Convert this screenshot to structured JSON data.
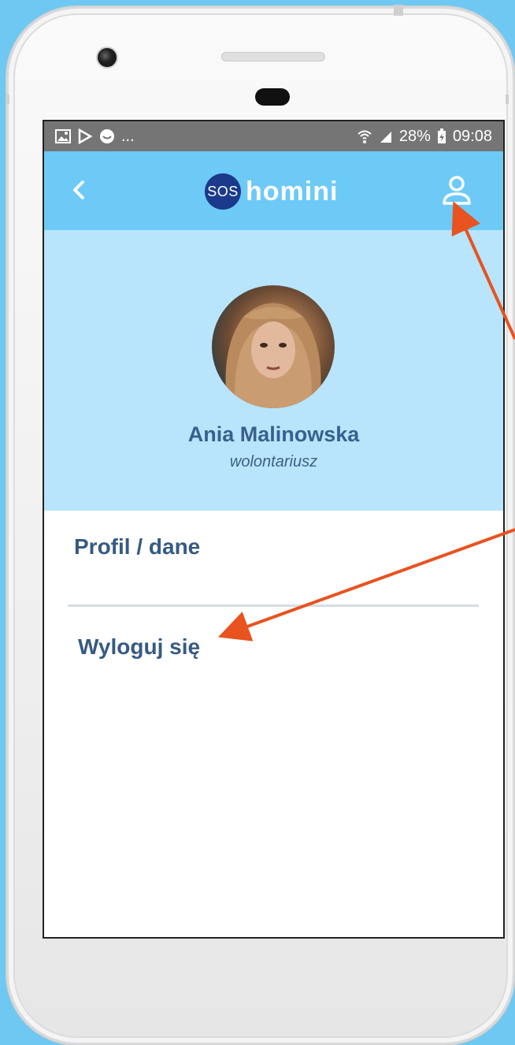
{
  "status_bar": {
    "left_icons": [
      "image-icon",
      "play-store-icon",
      "smile-icon"
    ],
    "left_more": "...",
    "battery_percent": "28%",
    "time": "09:08"
  },
  "app_bar": {
    "logo_badge": "SOS",
    "logo_word": "homini"
  },
  "profile": {
    "name": "Ania Malinowska",
    "role": "wolontariusz"
  },
  "menu": {
    "items": [
      {
        "label": "Profil / dane"
      },
      {
        "label": "Wyloguj się"
      }
    ]
  },
  "colors": {
    "background": "#6ec8f2",
    "app_bar": "#6dcaf7",
    "profile_bg": "#b8e5fb",
    "text_primary": "#365a82",
    "annotation_arrow": "#e8531f"
  }
}
